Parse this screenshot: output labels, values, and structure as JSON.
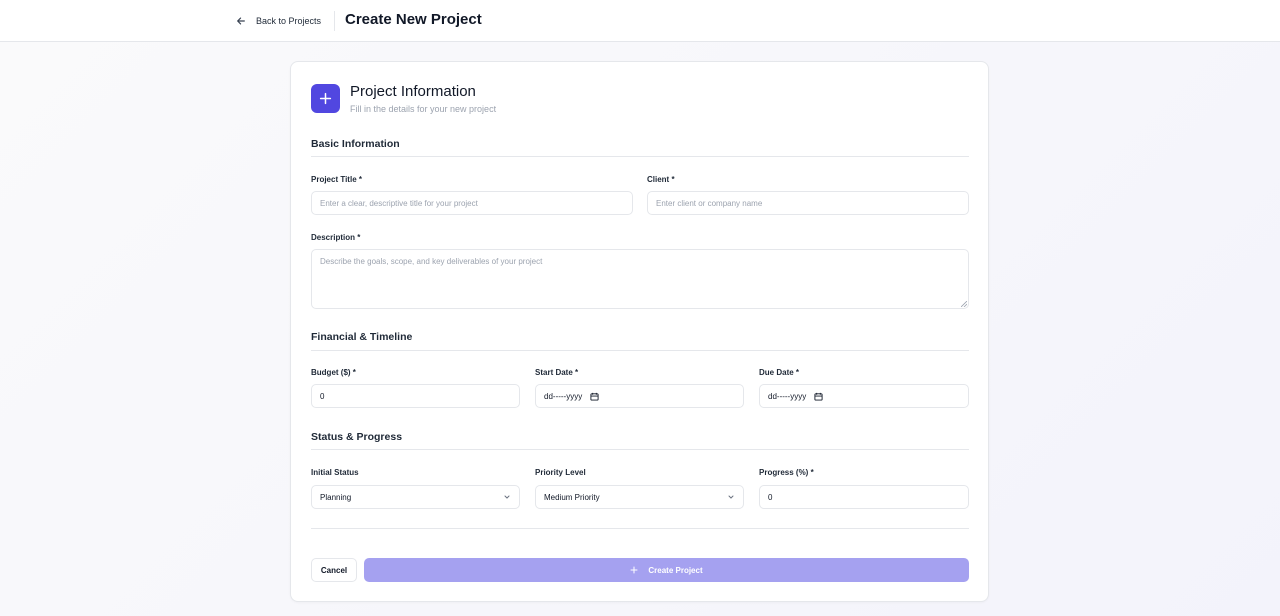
{
  "header": {
    "back_label": "Back to Projects",
    "title": "Create New Project"
  },
  "card": {
    "title": "Project Information",
    "subtitle": "Fill in the details for your new project",
    "icon": "plus-icon"
  },
  "sections": {
    "basic": "Basic Information",
    "financial": "Financial & Timeline",
    "status": "Status & Progress"
  },
  "fields": {
    "project_title": {
      "label": "Project Title *",
      "value": "",
      "placeholder": "Enter a clear, descriptive title for your project"
    },
    "client": {
      "label": "Client *",
      "value": "",
      "placeholder": "Enter client or company name"
    },
    "description": {
      "label": "Description *",
      "value": "",
      "placeholder": "Describe the goals, scope, and key deliverables of your project"
    },
    "budget": {
      "label": "Budget ($) *",
      "value": "0"
    },
    "start_date": {
      "label": "Start Date *",
      "value": "dd-----yyyy"
    },
    "due_date": {
      "label": "Due Date *",
      "value": "dd-----yyyy"
    },
    "initial_status": {
      "label": "Initial Status",
      "value": "Planning"
    },
    "priority": {
      "label": "Priority Level",
      "value": "Medium Priority"
    },
    "progress": {
      "label": "Progress (%) *",
      "value": "0"
    }
  },
  "actions": {
    "cancel": "Cancel",
    "create": "Create Project"
  },
  "colors": {
    "accent": "#5147e0",
    "button_disabled": "#a5a1f0",
    "border": "#e5e7eb",
    "muted_text": "#9ca3af"
  }
}
